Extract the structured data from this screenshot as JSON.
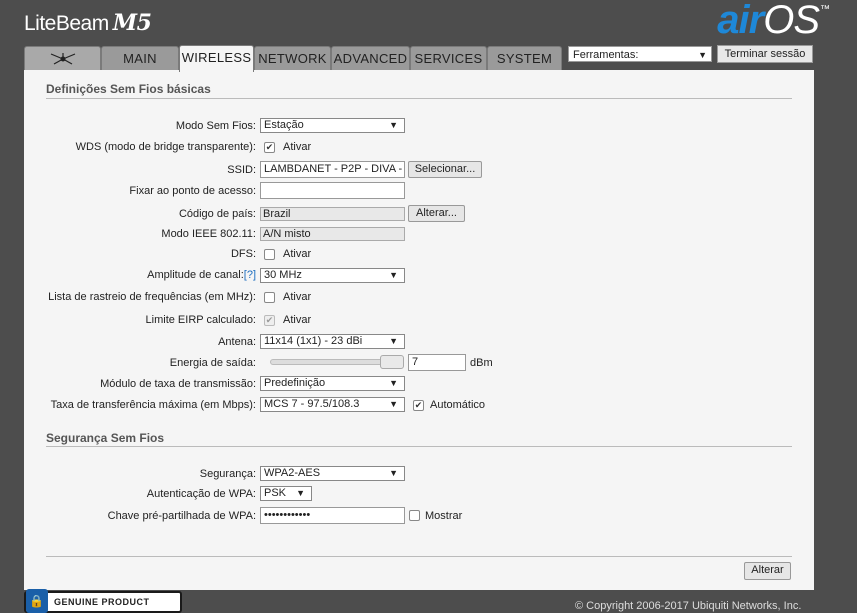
{
  "header": {
    "product": "LiteBeam",
    "model": "M5",
    "os_air": "air",
    "os_os": "OS",
    "trademark": "™"
  },
  "tabs": [
    {
      "label": ""
    },
    {
      "label": "MAIN"
    },
    {
      "label": "WIRELESS"
    },
    {
      "label": "NETWORK"
    },
    {
      "label": "ADVANCED"
    },
    {
      "label": "SERVICES"
    },
    {
      "label": "SYSTEM"
    }
  ],
  "tools": {
    "value": "Ferramentas:",
    "logout_label": "Terminar sessão"
  },
  "basic": {
    "title": "Definições Sem Fios básicas",
    "mode_label": "Modo Sem Fios:",
    "mode_value": "Estação",
    "wds_label": "WDS (modo de bridge transparente):",
    "wds_check": "Ativar",
    "ssid_label": "SSID:",
    "ssid_value": "LAMBDANET - P2P - DIVA -",
    "ssid_button": "Selecionar...",
    "ap_label": "Fixar ao ponto de acesso:",
    "ap_value": "",
    "country_label": "Código de país:",
    "country_value": "Brazil",
    "country_button": "Alterar...",
    "ieee_label": "Modo IEEE 802.11:",
    "ieee_value": "A/N misto",
    "dfs_label": "DFS:",
    "dfs_check": "Ativar",
    "width_label": "Amplitude de canal:",
    "width_help": "[?]",
    "width_value": "30 MHz",
    "scan_label": "Lista de rastreio de frequências (em MHz):",
    "scan_check": "Ativar",
    "eirp_label": "Limite EIRP calculado:",
    "eirp_check": "Ativar",
    "antenna_label": "Antena:",
    "antenna_value": "11x14 (1x1) - 23 dBi",
    "power_label": "Energia de saída:",
    "power_value": "7",
    "power_unit": "dBm",
    "rate_module_label": "Módulo de taxa de transmissão:",
    "rate_module_value": "Predefinição",
    "max_rate_label": "Taxa de transferência máxima (em Mbps):",
    "max_rate_value": "MCS 7 - 97.5/108.3",
    "auto_check": "Automático"
  },
  "security": {
    "title": "Segurança Sem Fios",
    "sec_label": "Segurança:",
    "sec_value": "WPA2-AES",
    "auth_label": "Autenticação de WPA:",
    "auth_value": "PSK",
    "key_label": "Chave pré-partilhada de WPA:",
    "key_value": "••••••••••••",
    "show_check": "Mostrar"
  },
  "actions": {
    "apply_label": "Alterar"
  },
  "footer": {
    "badge": "GENUINE PRODUCT",
    "copyright": "© Copyright 2006-2017 Ubiquiti Networks, Inc."
  },
  "colors": {
    "accent": "#1e88d8",
    "header_bg": "#4d4d4d",
    "panel_bg": "#f5f5f5"
  }
}
